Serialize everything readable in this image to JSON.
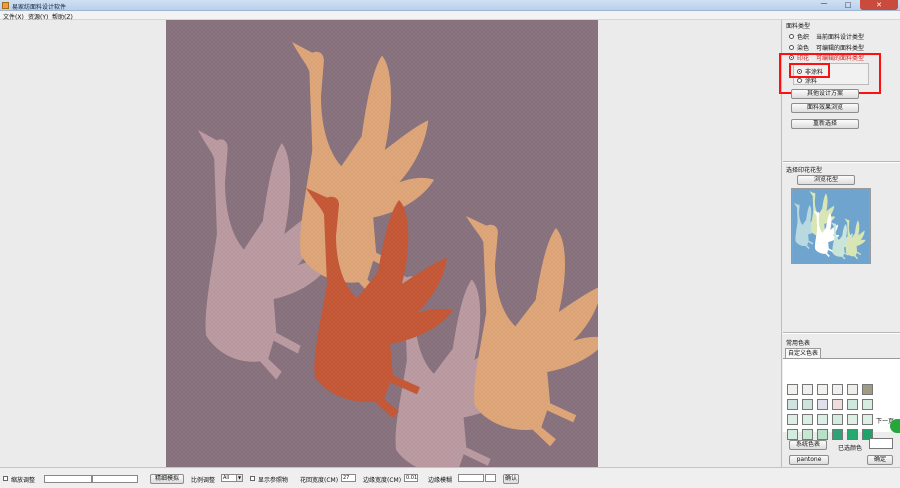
{
  "window": {
    "title": "易家纺面料设计软件",
    "controls": [
      "—",
      "□",
      "✕"
    ]
  },
  "menu": {
    "items": [
      "文件(X)",
      "资源(Y)",
      "帮助(Z)"
    ]
  },
  "canvas": {
    "background_color": "#8b7480",
    "cranes": [
      {
        "color": "#bd9da3",
        "label": "crane-back-left"
      },
      {
        "color": "#e1a87b",
        "label": "crane-top-center"
      },
      {
        "color": "#c85a38",
        "label": "crane-center-red"
      },
      {
        "color": "#bd9da3",
        "label": "crane-bottom-center"
      },
      {
        "color": "#e1a87b",
        "label": "crane-right"
      }
    ]
  },
  "panel": {
    "fabric_type": {
      "title": "面料类型",
      "options": [
        {
          "label": "色织",
          "desc": "当前面料设计类型",
          "selected": false,
          "highlight": false
        },
        {
          "label": "染色",
          "desc": "可编辑的面料类型",
          "selected": false,
          "highlight": false
        },
        {
          "label": "印花",
          "desc": "可编辑的面料类型",
          "selected": true,
          "highlight": true
        }
      ],
      "sub_options": [
        {
          "label": "非涂料",
          "selected": true
        },
        {
          "label": "涂料",
          "selected": false
        }
      ],
      "buttons": [
        "其他设计方案",
        "面料效果浏览",
        "重新选择"
      ]
    },
    "print_type": {
      "title": "选择印花花型",
      "browse_button": "浏览花型"
    },
    "colors": {
      "title": "常用色表",
      "tab": "自定义色表",
      "next_page": "下一页",
      "swatches": [
        [
          "#f1f1ee",
          "#eef0ed",
          "#f1f1ee",
          "#eef0ee",
          "#eceee9",
          "#9f9b84"
        ],
        [
          "#cfe3df",
          "#cfe2de",
          "#dfe0ea",
          "#f0dcdc",
          "#d0e7de",
          "#d7ede2"
        ],
        [
          "#dfede6",
          "#dbeee6",
          "#dcefe6",
          "#d4ecdf",
          "#def0e6",
          "#dfefe5"
        ],
        [
          "#d4ebdf",
          "#c6e7d2",
          "#b6e1c6",
          "#32a276",
          "#26a96e",
          "#1ea46b"
        ]
      ],
      "system_button": "系统色表",
      "selected_label": "已选颜色",
      "pantone_button": "pantone",
      "confirm_button": "确定"
    }
  },
  "status": {
    "zoom_label": "缩放调整",
    "fine_button": "精细模拟",
    "ratio_label": "比例调整",
    "ratio_value": "All",
    "show_ref_label": "显示参照物",
    "repeat_width_label": "花回宽度(CM)",
    "repeat_width_value": "27",
    "edge_width_label": "边缘宽度(CM)",
    "edge_width_value": "0.01",
    "edge_blur_label": "边缘模糊",
    "confirm_button": "确认"
  }
}
